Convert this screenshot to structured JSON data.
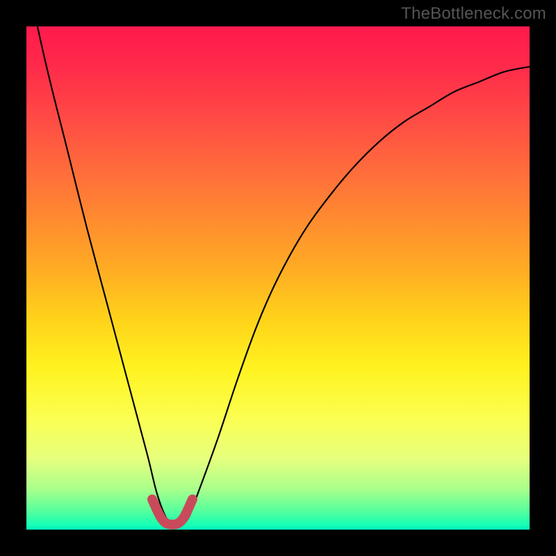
{
  "watermark": {
    "text": "TheBottleneck.com"
  },
  "colors": {
    "frame": "#000000",
    "curve": "#000000",
    "valley_highlight": "#c94a5a",
    "gradient_top": "#ff1a4d",
    "gradient_bottom": "#00f5c0"
  },
  "chart_data": {
    "type": "line",
    "title": "",
    "xlabel": "",
    "ylabel": "",
    "xlim": [
      0,
      100
    ],
    "ylim": [
      0,
      100
    ],
    "grid": false,
    "legend_position": "none",
    "annotations": [
      "TheBottleneck.com"
    ],
    "series": [
      {
        "name": "curve",
        "x": [
          0,
          4,
          8,
          12,
          16,
          20,
          24,
          26,
          28,
          30,
          32,
          34,
          38,
          42,
          46,
          50,
          55,
          60,
          65,
          70,
          75,
          80,
          85,
          90,
          95,
          100
        ],
        "y": [
          110,
          92,
          76,
          60,
          45,
          30,
          15,
          7,
          2,
          1,
          2,
          7,
          18,
          30,
          41,
          50,
          59,
          66,
          72,
          77,
          81,
          84,
          87,
          89,
          91,
          92
        ]
      },
      {
        "name": "valley-highlight",
        "x": [
          25,
          27,
          29,
          31,
          33
        ],
        "y": [
          6,
          2,
          1,
          2,
          6
        ]
      }
    ],
    "notes": "V-shaped bottleneck curve. The minimum is near x≈29 at y≈1. Left branch rises steeply toward the top-left corner; right branch rises with diminishing slope toward the upper-right. The valley segment is highlighted with a thick muted-red stroke. Background is a vertical rainbow gradient (red→green). No axis ticks, labels, or gridlines are shown."
  }
}
